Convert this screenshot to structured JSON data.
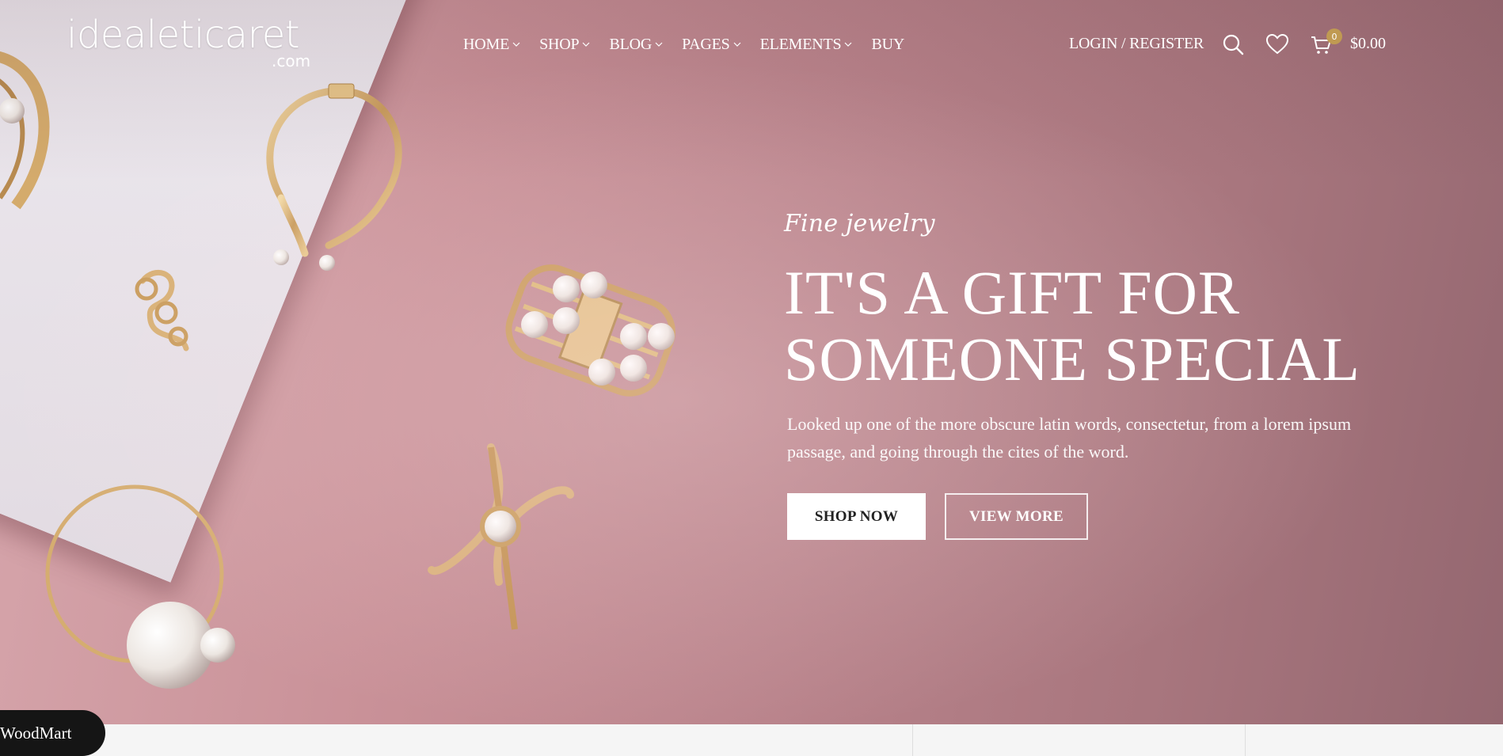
{
  "header": {
    "logo_main": "idealeticaret",
    "logo_sub": ".com",
    "nav": [
      {
        "label": "HOME",
        "has_dropdown": true
      },
      {
        "label": "SHOP",
        "has_dropdown": true
      },
      {
        "label": "BLOG",
        "has_dropdown": true
      },
      {
        "label": "PAGES",
        "has_dropdown": true
      },
      {
        "label": "ELEMENTS",
        "has_dropdown": true
      },
      {
        "label": "BUY",
        "has_dropdown": false
      }
    ],
    "login_label": "LOGIN / REGISTER",
    "icons": [
      "search-icon",
      "heart-icon",
      "cart-icon"
    ],
    "cart_count": "0",
    "cart_total": "$0.00"
  },
  "hero": {
    "tagline": "Fine jewelry",
    "headline_line1": "IT'S A GIFT FOR",
    "headline_line2": "SOMEONE SPECIAL",
    "description": "Looked up one of the more obscure latin words, consectetur, from a lorem ipsum passage, and going through the cites of the word.",
    "primary_button": "SHOP NOW",
    "secondary_button": "VIEW MORE"
  },
  "badge": {
    "label": "WoodMart"
  },
  "colors": {
    "hero_pink": "#c99198",
    "paper": "#ece8ee",
    "gold": "#c8a36a",
    "cart_badge": "#c09a52",
    "badge_bg": "#151515"
  }
}
